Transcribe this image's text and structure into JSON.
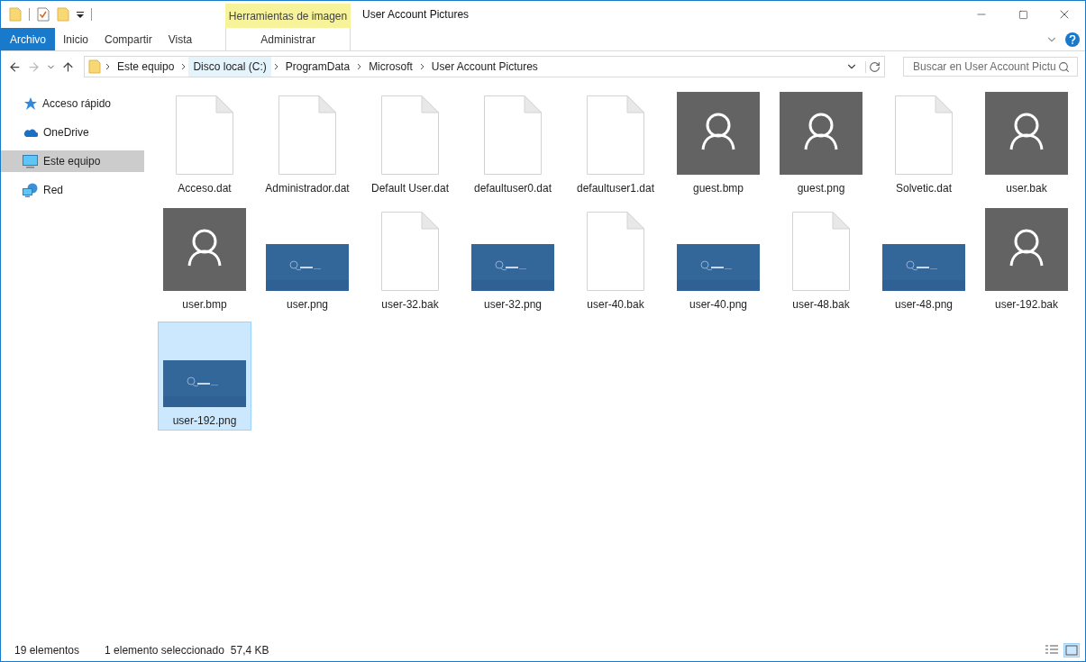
{
  "window": {
    "title": "User Account Pictures",
    "context_tab_group": "Herramientas de imagen"
  },
  "ribbon_tabs": [
    {
      "label": "Archivo",
      "kind": "file"
    },
    {
      "label": "Inicio",
      "kind": "tab"
    },
    {
      "label": "Compartir",
      "kind": "tab"
    },
    {
      "label": "Vista",
      "kind": "tab"
    },
    {
      "label": "Administrar",
      "kind": "contextual"
    }
  ],
  "address": {
    "crumbs": [
      {
        "label": "Este equipo",
        "hovered": false
      },
      {
        "label": "Disco local (C:)",
        "hovered": true
      },
      {
        "label": "ProgramData",
        "hovered": false
      },
      {
        "label": "Microsoft",
        "hovered": false
      },
      {
        "label": "User Account Pictures",
        "hovered": false
      }
    ]
  },
  "search": {
    "placeholder": "Buscar en User Account Pictu"
  },
  "sidebar": {
    "items": [
      {
        "label": "Acceso rápido",
        "kind": "quick",
        "selected": false
      },
      {
        "label": "OneDrive",
        "kind": "cloud",
        "selected": false
      },
      {
        "label": "Este equipo",
        "kind": "computer",
        "selected": true
      },
      {
        "label": "Red",
        "kind": "network",
        "selected": false
      }
    ]
  },
  "files": [
    {
      "name": "Acceso.dat",
      "kind": "document",
      "selected": false
    },
    {
      "name": "Administrador.dat",
      "kind": "document",
      "selected": false
    },
    {
      "name": "Default User.dat",
      "kind": "document",
      "selected": false
    },
    {
      "name": "defaultuser0.dat",
      "kind": "document",
      "selected": false
    },
    {
      "name": "defaultuser1.dat",
      "kind": "document",
      "selected": false
    },
    {
      "name": "guest.bmp",
      "kind": "avatar",
      "selected": false
    },
    {
      "name": "guest.png",
      "kind": "avatar",
      "selected": false
    },
    {
      "name": "Solvetic.dat",
      "kind": "document",
      "selected": false
    },
    {
      "name": "user.bak",
      "kind": "avatar",
      "selected": false
    },
    {
      "name": "user.bmp",
      "kind": "avatar",
      "selected": false
    },
    {
      "name": "user.png",
      "selected": false
    },
    {
      "name": "user-32.bak",
      "kind": "document",
      "selected": false
    },
    {
      "name": "user-32.png",
      "selected": false
    },
    {
      "name": "user-40.bak",
      "kind": "document",
      "selected": false
    },
    {
      "name": "user-40.png",
      "selected": false
    },
    {
      "name": "user-48.bak",
      "kind": "document",
      "selected": false
    },
    {
      "name": "user-48.png",
      "selected": false
    },
    {
      "name": "user-192.bak",
      "kind": "avatar",
      "selected": false
    },
    {
      "name": "user-192.png",
      "selected": true
    }
  ],
  "status_bar": {
    "count": "19 elementos",
    "selection": "1 elemento seleccionado",
    "size": "57,4 KB"
  }
}
